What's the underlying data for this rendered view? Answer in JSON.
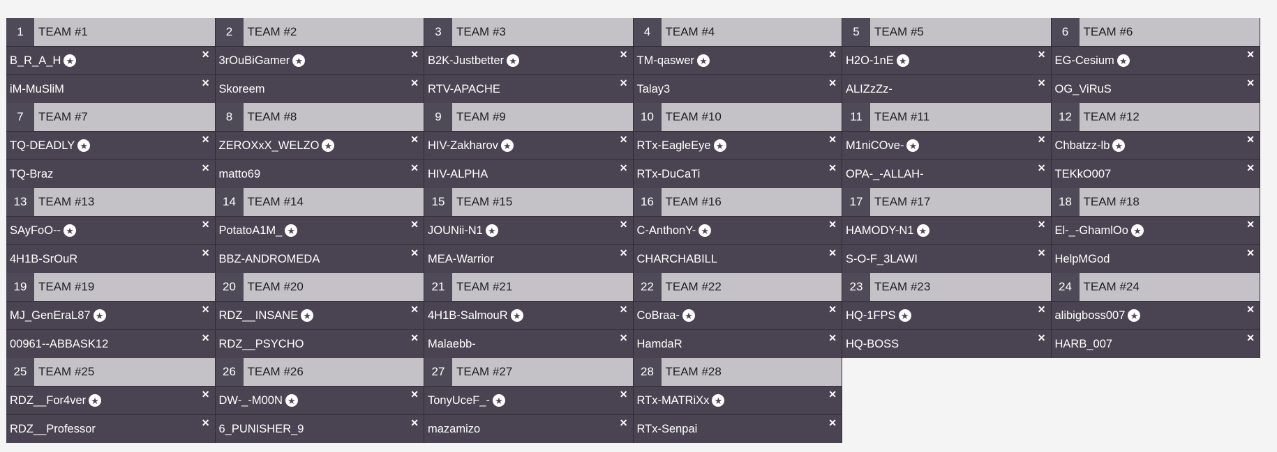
{
  "icons": {
    "captain": "star-circle-icon",
    "remove": "close-icon"
  },
  "glyphs": {
    "captain": "★",
    "remove": "✕"
  },
  "teams": [
    {
      "number": "1",
      "name": "TEAM #1",
      "players": [
        "B_R_A_H",
        "iM-MuSliM"
      ]
    },
    {
      "number": "2",
      "name": "TEAM #2",
      "players": [
        "3rOuBiGamer",
        "Skoreem"
      ]
    },
    {
      "number": "3",
      "name": "TEAM #3",
      "players": [
        "B2K-Justbetter",
        "RTV-APACHE"
      ]
    },
    {
      "number": "4",
      "name": "TEAM #4",
      "players": [
        "TM-qaswer",
        "Talay3"
      ]
    },
    {
      "number": "5",
      "name": "TEAM #5",
      "players": [
        "H2O-1nE",
        "ALIZzZz-"
      ]
    },
    {
      "number": "6",
      "name": "TEAM #6",
      "players": [
        "EG-Cesium",
        "OG_ViRuS"
      ]
    },
    {
      "number": "7",
      "name": "TEAM #7",
      "players": [
        "TQ-DEADLY",
        "TQ-Braz"
      ]
    },
    {
      "number": "8",
      "name": "TEAM #8",
      "players": [
        "ZEROXxX_WELZO",
        "matto69"
      ]
    },
    {
      "number": "9",
      "name": "TEAM #9",
      "players": [
        "HIV-Zakharov",
        "HIV-ALPHA"
      ]
    },
    {
      "number": "10",
      "name": "TEAM #10",
      "players": [
        "RTx-EagleEye",
        "RTx-DuCaTi"
      ]
    },
    {
      "number": "11",
      "name": "TEAM #11",
      "players": [
        "M1niCOve-",
        "OPA-_-ALLAH-"
      ]
    },
    {
      "number": "12",
      "name": "TEAM #12",
      "players": [
        "Chbatzz-lb",
        "TEKkO007"
      ]
    },
    {
      "number": "13",
      "name": "TEAM #13",
      "players": [
        "SAyFoO--",
        "4H1B-SrOuR"
      ]
    },
    {
      "number": "14",
      "name": "TEAM #14",
      "players": [
        "PotatoA1M_",
        "BBZ-ANDROMEDA"
      ]
    },
    {
      "number": "15",
      "name": "TEAM #15",
      "players": [
        "JOUNii-N1",
        "MEA-Warrior"
      ]
    },
    {
      "number": "16",
      "name": "TEAM #16",
      "players": [
        "C-AnthonY-",
        "CHARCHABILL"
      ]
    },
    {
      "number": "17",
      "name": "TEAM #17",
      "players": [
        "HAMODY-N1",
        "S-O-F_3LAWI"
      ]
    },
    {
      "number": "18",
      "name": "TEAM #18",
      "players": [
        "El-_-GhamlOo",
        "HelpMGod"
      ]
    },
    {
      "number": "19",
      "name": "TEAM #19",
      "players": [
        "MJ_GenEraL87",
        "00961--ABBASK12"
      ]
    },
    {
      "number": "20",
      "name": "TEAM #20",
      "players": [
        "RDZ__INSANE",
        "RDZ__PSYCHO"
      ]
    },
    {
      "number": "21",
      "name": "TEAM #21",
      "players": [
        "4H1B-SalmouR",
        "Malaebb-"
      ]
    },
    {
      "number": "22",
      "name": "TEAM #22",
      "players": [
        "CoBraa-",
        "HamdaR"
      ]
    },
    {
      "number": "23",
      "name": "TEAM #23",
      "players": [
        "HQ-1FPS",
        "HQ-BOSS"
      ]
    },
    {
      "number": "24",
      "name": "TEAM #24",
      "players": [
        "alibigboss007",
        "HARB_007"
      ]
    },
    {
      "number": "25",
      "name": "TEAM #25",
      "players": [
        "RDZ__For4ver",
        "RDZ__Professor"
      ]
    },
    {
      "number": "26",
      "name": "TEAM #26",
      "players": [
        "DW-_-M00N",
        "6_PUNISHER_9"
      ]
    },
    {
      "number": "27",
      "name": "TEAM #27",
      "players": [
        "TonyUceF_-",
        "mazamizo"
      ]
    },
    {
      "number": "28",
      "name": "TEAM #28",
      "players": [
        "RTx-MATRiXx",
        "RTx-Senpai"
      ]
    }
  ]
}
